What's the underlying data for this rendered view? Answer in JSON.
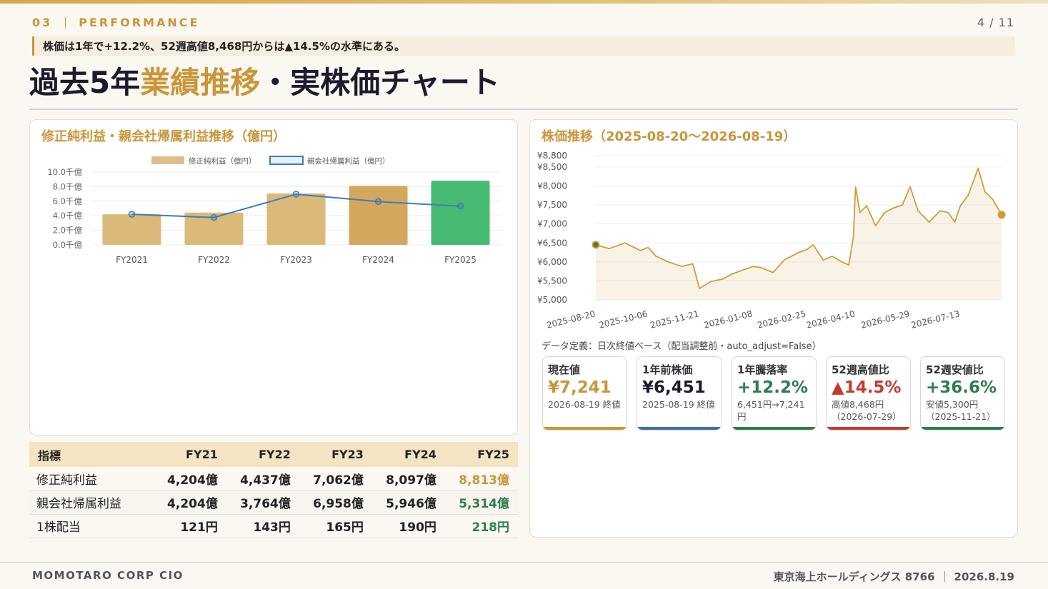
{
  "header": {
    "section_number": "03",
    "section_name": "PERFORMANCE",
    "page": "4 / 11",
    "lead": "株価は1年で+12.2%、52週高値8,468円からは▲14.5%の水準にある。",
    "title_pre": "過去5年",
    "title_accent": "業績推移",
    "title_post": "・実株価チャート"
  },
  "left_card": {
    "title": "修正純利益・親会社帰属利益推移（億円）"
  },
  "right_card": {
    "title": "株価推移（2025-08-20〜2026-08-19）",
    "data_note": "データ定義：日次終値ベース（配当調整前・auto_adjust=False）"
  },
  "chart_data": [
    {
      "type": "bar",
      "categories": [
        "FY2021",
        "FY2022",
        "FY2023",
        "FY2024",
        "FY2025"
      ],
      "series": [
        {
          "name": "修正純利益（億円）",
          "kind": "bar",
          "values": [
            4204,
            4437,
            7062,
            8097,
            8813
          ],
          "colors": [
            "#dbb979",
            "#dbb979",
            "#dbb979",
            "#d3a85e",
            "#47bb73"
          ]
        },
        {
          "name": "親会社帰属利益（億円）",
          "kind": "line",
          "values": [
            4204,
            3764,
            6958,
            5946,
            5314
          ],
          "color": "#3f7cb6"
        }
      ],
      "yticks": [
        "0.0千億",
        "2.0千億",
        "4.0千億",
        "6.0千億",
        "8.0千億",
        "10.0千億"
      ],
      "ylim": [
        0,
        10000
      ],
      "legend": "top"
    },
    {
      "type": "area",
      "x": [
        "2025-08-20",
        "2025-09-01",
        "2025-09-15",
        "2025-09-29",
        "2025-10-06",
        "2025-10-13",
        "2025-10-24",
        "2025-11-05",
        "2025-11-15",
        "2025-11-21",
        "2025-12-01",
        "2025-12-12",
        "2025-12-20",
        "2026-01-08",
        "2026-01-15",
        "2026-01-26",
        "2026-02-05",
        "2026-02-18",
        "2026-02-25",
        "2026-03-03",
        "2026-03-12",
        "2026-03-20",
        "2026-03-30",
        "2026-04-04",
        "2026-04-08",
        "2026-04-10",
        "2026-04-14",
        "2026-04-20",
        "2026-04-28",
        "2026-05-06",
        "2026-05-14",
        "2026-05-22",
        "2026-05-29",
        "2026-06-05",
        "2026-06-15",
        "2026-06-25",
        "2026-07-02",
        "2026-07-08",
        "2026-07-13",
        "2026-07-20",
        "2026-07-29",
        "2026-08-04",
        "2026-08-11",
        "2026-08-19"
      ],
      "y": [
        6451,
        6350,
        6500,
        6300,
        6380,
        6150,
        6000,
        5880,
        5950,
        5300,
        5480,
        5550,
        5680,
        5880,
        5850,
        5720,
        6050,
        6250,
        6320,
        6450,
        6050,
        6150,
        5980,
        5920,
        6650,
        7980,
        7300,
        7480,
        6950,
        7300,
        7420,
        7500,
        7980,
        7350,
        7050,
        7350,
        7300,
        7050,
        7480,
        7750,
        8468,
        7850,
        7650,
        7241
      ],
      "yticks": [
        "¥5,000",
        "¥5,500",
        "¥6,000",
        "¥6,500",
        "¥7,000",
        "¥7,500",
        "¥8,000",
        "¥8,500",
        "¥8,800"
      ],
      "xticks": [
        "2025-08-20",
        "2025-10-06",
        "2025-11-21",
        "2026-01-08",
        "2026-02-25",
        "2026-04-10",
        "2026-05-29",
        "2026-07-13"
      ],
      "ylim": [
        5000,
        8800
      ],
      "color": "#d09b3c"
    }
  ],
  "table": {
    "headers": [
      "指標",
      "FY21",
      "FY22",
      "FY23",
      "FY24",
      "FY25"
    ],
    "rows": [
      [
        "修正純利益",
        "4,204億",
        "4,437億",
        "7,062億",
        "8,097億",
        "8,813億"
      ],
      [
        "親会社帰属利益",
        "4,204億",
        "3,764億",
        "6,958億",
        "5,946億",
        "5,314億"
      ],
      [
        "1株配当",
        "121円",
        "143円",
        "165円",
        "190円",
        "218円"
      ]
    ]
  },
  "kpis": [
    {
      "label": "現在値",
      "value": "¥7,241",
      "sub": "2026-08-19 終値",
      "color": "#c9963a"
    },
    {
      "label": "1年前株価",
      "value": "¥6,451",
      "sub": "2025-08-19 終値",
      "color": "#1b1b2b",
      "bar": "#3a70b4"
    },
    {
      "label": "1年騰落率",
      "value": "+12.2%",
      "sub": "6,451円→7,241円",
      "color": "#2e7d4f"
    },
    {
      "label": "52週高値比",
      "value": "▲14.5%",
      "sub": "高値8,468円（2026-07-29）",
      "color": "#c63a2e"
    },
    {
      "label": "52週安値比",
      "value": "+36.6%",
      "sub": "安値5,300円（2025-11-21）",
      "color": "#2e7d4f"
    }
  ],
  "footer": {
    "left": "MOMOTARO CORP CIO",
    "company": "東京海上ホールディングス 8766",
    "date": "2026.8.19"
  }
}
